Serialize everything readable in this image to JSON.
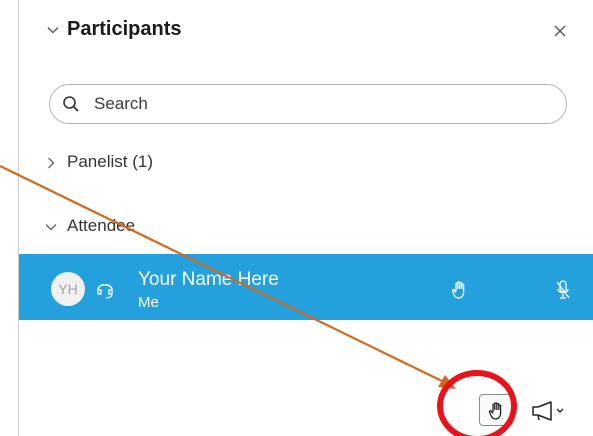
{
  "panel": {
    "title": "Participants",
    "close_icon": "close-icon",
    "collapse_icon": "chevron-down-icon"
  },
  "search": {
    "placeholder": "Search",
    "icon": "search-icon"
  },
  "sections": {
    "panelist": {
      "label": "Panelist (1)",
      "expanded": false
    },
    "attendee": {
      "label": "Attendee",
      "expanded": true
    }
  },
  "participant": {
    "initials": "YH",
    "name": "Your Name Here",
    "subtitle": "Me",
    "audio_icon": "headset-icon",
    "hand_icon": "raised-hand-icon",
    "mic_icon": "mic-muted-icon"
  },
  "controls": {
    "raise_hand_icon": "raise-hand-icon",
    "announce_icon": "megaphone-icon"
  },
  "colors": {
    "selected_row": "#24a0dd",
    "annotation_arrow": "#d2691e",
    "annotation_circle": "#e8121a"
  }
}
